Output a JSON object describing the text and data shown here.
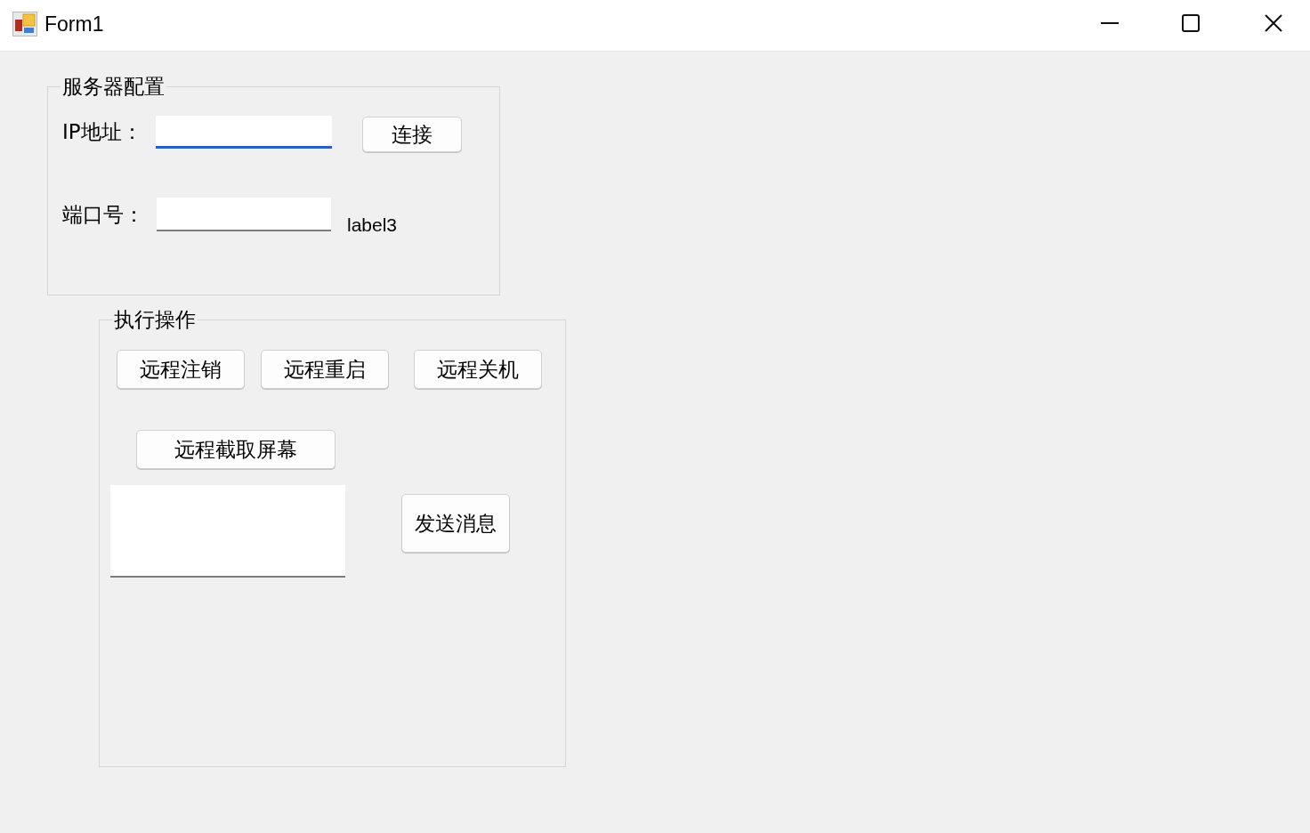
{
  "window": {
    "title": "Form1"
  },
  "server_config": {
    "title": "服务器配置",
    "ip": {
      "label": "IP地址：",
      "focused": true
    },
    "connect_button": "连接",
    "port": {
      "label": "端口号：",
      "focused": false
    },
    "side_label": "label3"
  },
  "operations": {
    "title": "执行操作",
    "buttons": [
      "远程注销",
      "远程重启",
      "远程关机"
    ],
    "screenshot_button": "远程截取屏幕",
    "message_box": {
      "focused": false
    },
    "send_button": "发送消息"
  }
}
